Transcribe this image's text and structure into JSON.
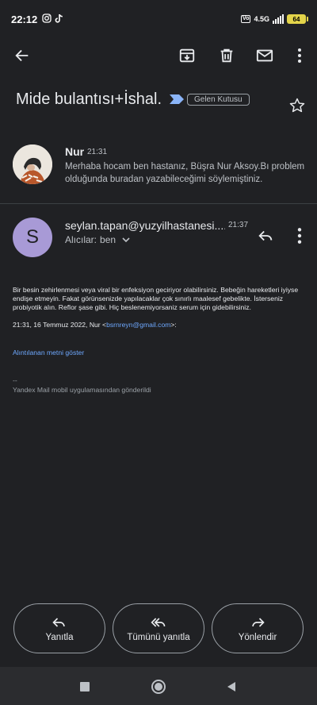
{
  "status_bar": {
    "time": "22:12",
    "network": "4.5G",
    "battery": "64"
  },
  "toolbar": {
    "icons": [
      "back-arrow-icon",
      "archive-icon",
      "delete-icon",
      "mark-unread-icon",
      "more-vert-icon"
    ]
  },
  "thread": {
    "subject": "Mide bulantısı+İshal.",
    "label": "Gelen Kutusu"
  },
  "message1": {
    "sender": "Nur",
    "time": "21:31",
    "snippet": "Merhaba hocam ben hastanız, Büşra Nur Aksoy.Bı problem olduğunda buradan yazabileceğimi söylemiştiniz."
  },
  "message2": {
    "avatar_letter": "S",
    "avatar_color": "#a89ad6",
    "from": "seylan.tapan@yuzyilhastanesi....",
    "time": "21:37",
    "to_label": "Alıcılar:",
    "to_value": "ben",
    "body": "Bir besin zehirlenmesi veya viral bir enfeksiyon geciriyor olabilirsiniz. Bebeğin hareketleri iyiyse endişe etmeyin. Fakat görünsenizde yapılacaklar çok sınırlı maalesef gebelikte. İsterseniz probiyotik alın. Reflor şase gibi. Hiç beslenemiyorsaniz serum için gidebilirsiniz.",
    "quote_prefix": "21:31, 16 Temmuz 2022, Nur <",
    "quote_email": "bsrnreyn@gmail.com",
    "quote_suffix": ">:",
    "show_quoted": "Alıntılanan metni göster",
    "sig_dash": "--",
    "signature": "Yandex Mail mobil uygulamasından gönderildi"
  },
  "actions": {
    "reply": "Yanıtla",
    "reply_all": "Tümünü yanıtla",
    "forward": "Yönlendir"
  },
  "colors": {
    "background": "#202124",
    "link": "#6ea8fe",
    "important_marker": "#8ab4f8",
    "battery": "#e3d44a"
  }
}
